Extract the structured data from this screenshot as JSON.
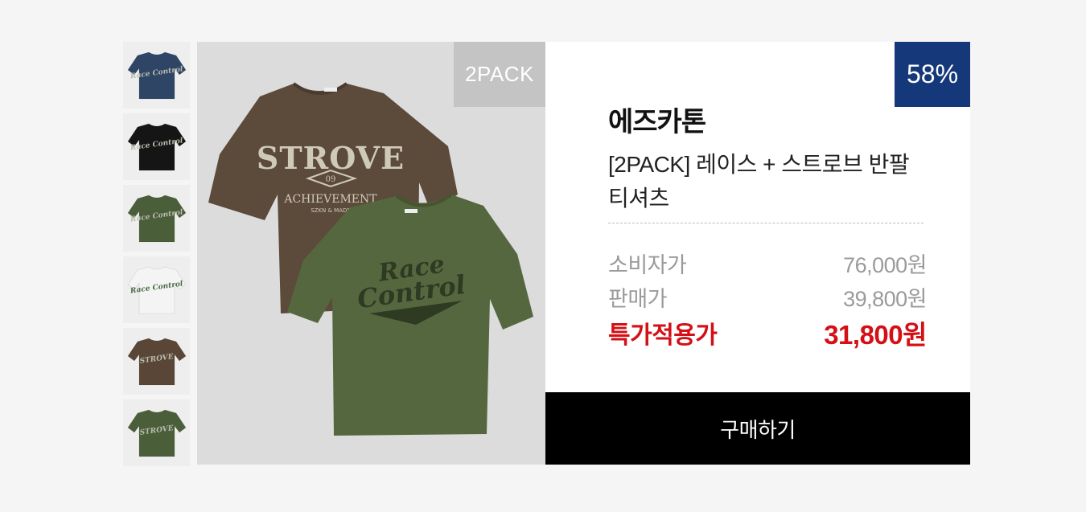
{
  "thumbnails": [
    {
      "name": "navy-tshirt",
      "color": "#2e4566",
      "print": "Race Control"
    },
    {
      "name": "black-tshirt",
      "color": "#151515",
      "print": "Race Control"
    },
    {
      "name": "green-tshirt",
      "color": "#4b5e3a",
      "print": "Race Control"
    },
    {
      "name": "white-tshirt",
      "color": "#f4f4f4",
      "print": "Race Control"
    },
    {
      "name": "brown-tshirt",
      "color": "#5a4636",
      "print": "STROVE"
    },
    {
      "name": "green-strove-tshirt",
      "color": "#4b5e3a",
      "print": "STROVE"
    }
  ],
  "main_image": {
    "badge": "2PACK",
    "back_shirt": {
      "color": "#5c4a3b",
      "print_title": "STROVE",
      "print_sub": "ACHIEVEMENT",
      "print_small": "SZKN & MADE",
      "print_num": "09"
    },
    "front_shirt": {
      "color": "#55673f",
      "print_line1": "Race",
      "print_line2": "Control"
    }
  },
  "product": {
    "discount": "58%",
    "brand": "에즈카톤",
    "name": "[2PACK] 레이스 + 스트로브 반팔 티셔츠",
    "prices": [
      {
        "label": "소비자가",
        "value": "76,000원"
      },
      {
        "label": "판매가",
        "value": "39,800원"
      },
      {
        "label": "특가적용가",
        "value": "31,800원"
      }
    ]
  },
  "buy_button": "구매하기",
  "colors": {
    "discount_bg": "#15387a",
    "sale_red": "#d40f16",
    "button_bg": "#000000"
  }
}
